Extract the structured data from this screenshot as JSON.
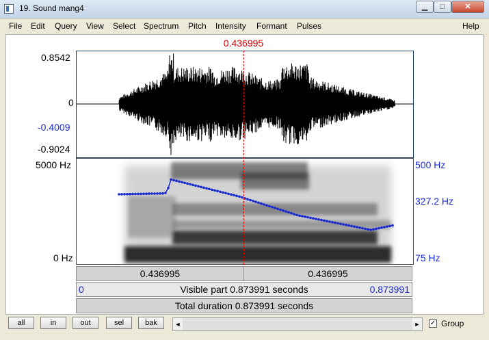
{
  "window": {
    "title": "19. Sound mang4",
    "minimize": "▁",
    "maximize": "□",
    "close": "✕"
  },
  "menu": [
    "File",
    "Edit",
    "Query",
    "View",
    "Select",
    "Spectrum",
    "Pitch",
    "Intensity",
    "Formant",
    "Pulses"
  ],
  "menu_help": "Help",
  "cursor": {
    "time_label": "0.436995"
  },
  "waveform": {
    "y_top": "0.8542",
    "y_zero": "0",
    "y_sel": "-0.4009",
    "y_bottom": "-0.9024"
  },
  "spectrogram": {
    "freq_top": "5000 Hz",
    "freq_bottom": "0 Hz",
    "pitch_top": "500 Hz",
    "pitch_mid": "327.2 Hz",
    "pitch_bottom": "75 Hz"
  },
  "infobars": {
    "left_part": "0.436995",
    "right_part": "0.436995",
    "visible_start": "0",
    "visible_label": "Visible part 0.873991 seconds",
    "visible_end": "0.873991",
    "total_label": "Total duration 0.873991 seconds"
  },
  "bottom_buttons": [
    "all",
    "in",
    "out",
    "sel",
    "bak"
  ],
  "scroll": {
    "left_arrow": "◄",
    "right_arrow": "►"
  },
  "group": {
    "label": "Group",
    "checked": "✓"
  },
  "colors": {
    "cursor": "#e00000",
    "pitch": "#1a2ad0",
    "blue_axis": "#1a2ad0"
  }
}
